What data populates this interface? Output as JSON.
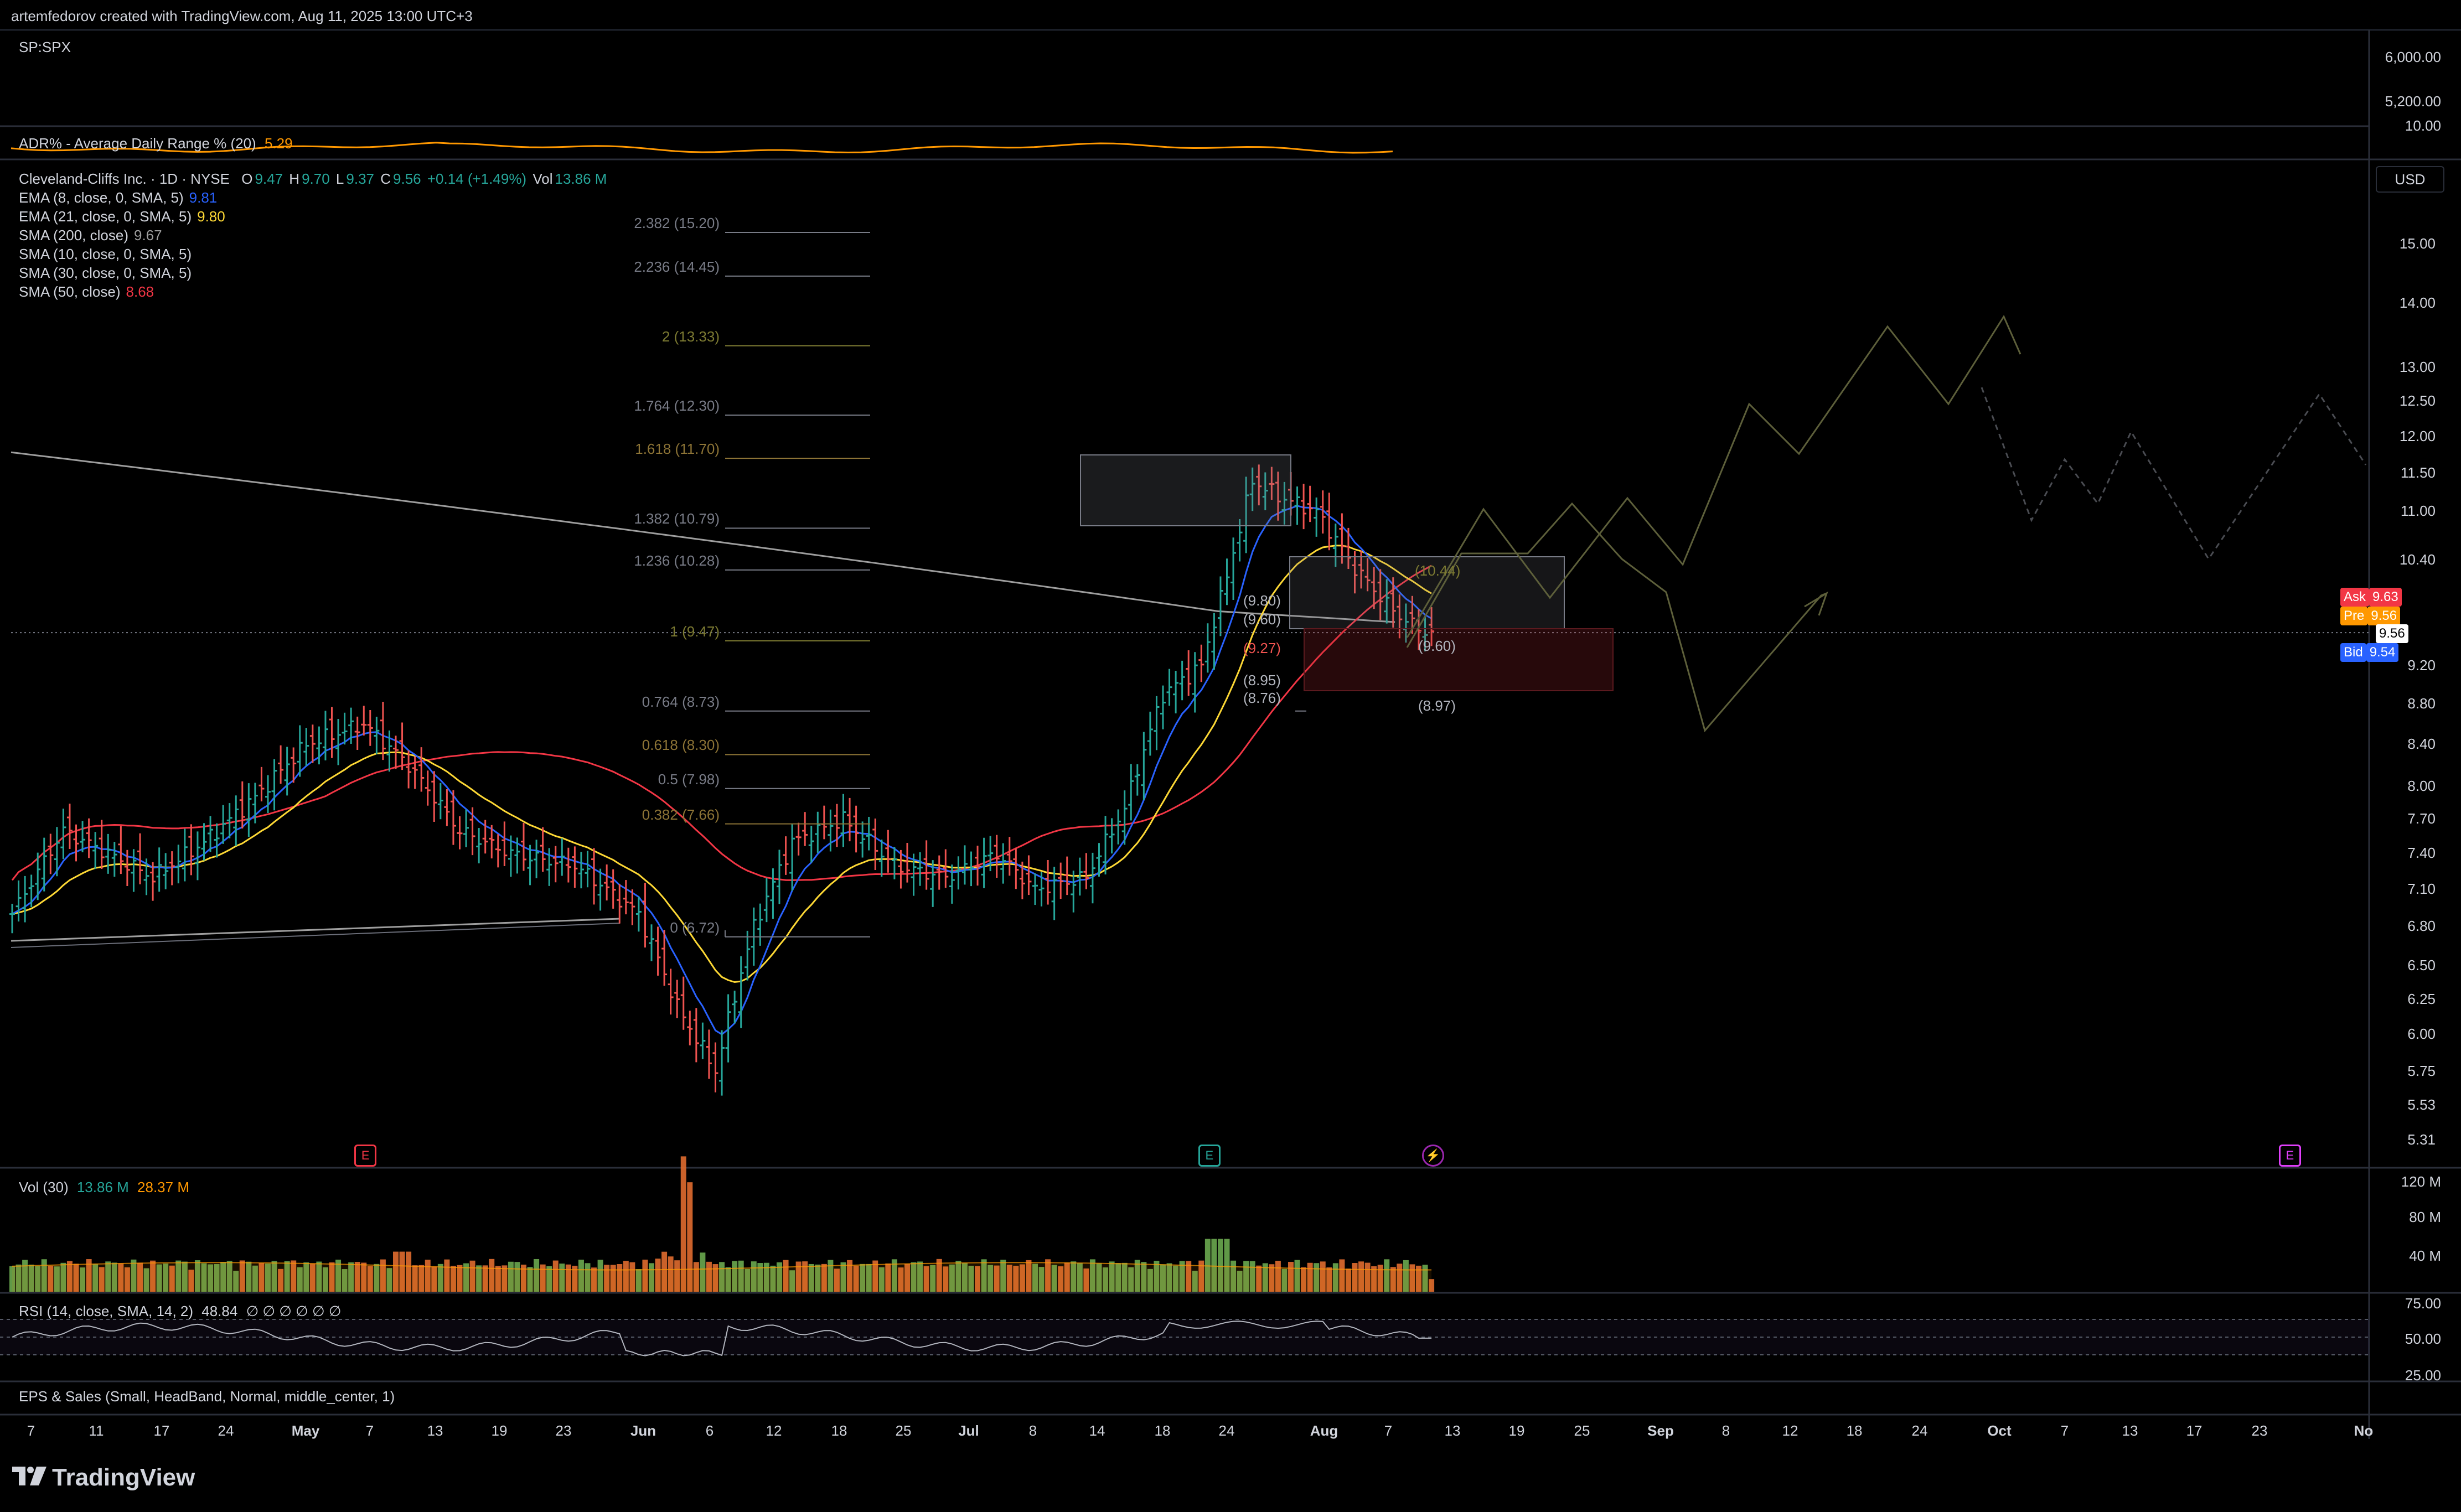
{
  "header": {
    "created_by": "artemfedorov created with TradingView.com, Aug 11, 2025 13:00 UTC+3"
  },
  "top_pane": {
    "symbol": "SP:SPX",
    "price_ticks": [
      "6,000.00",
      "5,200.00",
      "10.00"
    ]
  },
  "adr_indicator": {
    "label": "ADR% - Average Daily Range % (20)",
    "value": "5.29"
  },
  "main_legend": {
    "title": "Cleveland-Cliffs Inc. · 1D · NYSE",
    "open_label": "O",
    "open": "9.47",
    "high_label": "H",
    "high": "9.70",
    "low_label": "L",
    "low": "9.37",
    "close_label": "C",
    "close": "9.56",
    "change": "+0.14 (+1.49%)",
    "vol_label": "Vol",
    "vol": "13.86 M",
    "indicators": [
      {
        "label": "EMA (8, close, 0, SMA, 5)",
        "value": "9.81",
        "color": "#2962ff"
      },
      {
        "label": "EMA (21, close, 0, SMA, 5)",
        "value": "9.80",
        "color": "#fdd835"
      },
      {
        "label": "SMA (200, close)",
        "value": "9.67",
        "color": "#9e9e9e"
      },
      {
        "label": "SMA (10, close, 0, SMA, 5)",
        "value": "",
        "color": "#9e9e9e"
      },
      {
        "label": "SMA (30, close, 0, SMA, 5)",
        "value": "",
        "color": "#9e9e9e"
      },
      {
        "label": "SMA (50, close)",
        "value": "8.68",
        "color": "#f23645"
      }
    ]
  },
  "currency_button": "USD",
  "price_axis": [
    {
      "label": "15.00",
      "value": 15.0
    },
    {
      "label": "14.00",
      "value": 14.0
    },
    {
      "label": "13.00",
      "value": 13.0
    },
    {
      "label": "12.50",
      "value": 12.5
    },
    {
      "label": "12.00",
      "value": 12.0
    },
    {
      "label": "11.50",
      "value": 11.5
    },
    {
      "label": "11.00",
      "value": 11.0
    },
    {
      "label": "10.40",
      "value": 10.4
    },
    {
      "label": "9.20",
      "value": 9.2
    },
    {
      "label": "8.80",
      "value": 8.8
    },
    {
      "label": "8.40",
      "value": 8.4
    },
    {
      "label": "8.00",
      "value": 8.0
    },
    {
      "label": "7.70",
      "value": 7.7
    },
    {
      "label": "7.40",
      "value": 7.4
    },
    {
      "label": "7.10",
      "value": 7.1
    },
    {
      "label": "6.80",
      "value": 6.8
    },
    {
      "label": "6.50",
      "value": 6.5
    },
    {
      "label": "6.25",
      "value": 6.25
    },
    {
      "label": "6.00",
      "value": 6.0
    },
    {
      "label": "5.75",
      "value": 5.75
    },
    {
      "label": "5.53",
      "value": 5.53
    },
    {
      "label": "5.31",
      "value": 5.31
    }
  ],
  "price_tags": [
    {
      "label": "Ask",
      "value": "9.63",
      "color": "#f23645"
    },
    {
      "label": "Pre",
      "value": "9.56",
      "color": "#ff9800"
    },
    {
      "label": "",
      "value": "9.56",
      "color": "#ffffff"
    },
    {
      "label": "Bid",
      "value": "9.54",
      "color": "#2962ff"
    }
  ],
  "fibonacci": {
    "levels": [
      {
        "label": "2.382 (15.20)",
        "price": 15.2,
        "color": "#787b86"
      },
      {
        "label": "2.236 (14.45)",
        "price": 14.45,
        "color": "#787b86"
      },
      {
        "label": "2 (13.33)",
        "price": 13.33,
        "color": "#7c7a32"
      },
      {
        "label": "1.764 (12.30)",
        "price": 12.3,
        "color": "#787b86"
      },
      {
        "label": "1.618 (11.70)",
        "price": 11.7,
        "color": "#8d7436"
      },
      {
        "label": "1.382 (10.79)",
        "price": 10.79,
        "color": "#787b86"
      },
      {
        "label": "1.236 (10.28)",
        "price": 10.28,
        "color": "#787b86"
      },
      {
        "label": "1 (9.47)",
        "price": 9.47,
        "color": "#7c7a32"
      },
      {
        "label": "0.764 (8.73)",
        "price": 8.73,
        "color": "#787b86"
      },
      {
        "label": "0.618 (8.30)",
        "price": 8.3,
        "color": "#8d7436"
      },
      {
        "label": "0.5 (7.98)",
        "price": 7.98,
        "color": "#787b86"
      },
      {
        "label": "0.382 (7.66)",
        "price": 7.66,
        "color": "#8d7436"
      },
      {
        "label": "0 (6.72)",
        "price": 6.72,
        "color": "#787b86"
      }
    ]
  },
  "annotations": {
    "box_upper": "(10.44)",
    "box_level_1": "(9.80)",
    "box_level_2": "(9.60)",
    "box_level_3": "(9.27)",
    "box_level_4": "(8.95)",
    "box_level_5": "(8.76)",
    "right_level_1": "(9.60)",
    "right_level_2": "(8.97)"
  },
  "event_markers": [
    {
      "glyph": "E",
      "color": "#f23645",
      "date_index": 55
    },
    {
      "glyph": "E",
      "color": "#26a69a",
      "date_index": 187
    },
    {
      "glyph": "⚡",
      "color": "#9c27b0",
      "date_index": 222
    },
    {
      "glyph": "E",
      "color": "#e040fb",
      "date_index": 356
    }
  ],
  "volume_pane": {
    "label": "Vol (30)",
    "value_1": "13.86 M",
    "value_2": "28.37 M",
    "axis": [
      "120 M",
      "80 M",
      "40 M"
    ]
  },
  "rsi_pane": {
    "label": "RSI (14, close, SMA, 14, 2)",
    "value": "48.84",
    "empty_values": "∅ ∅ ∅ ∅ ∅ ∅",
    "axis": [
      "75.00",
      "50.00",
      "25.00"
    ]
  },
  "eps_pane": {
    "label": "EPS & Sales (Small, HeadBand, Normal, middle_center, 1)"
  },
  "time_axis": [
    {
      "label": "7",
      "month": false
    },
    {
      "label": "11",
      "month": false
    },
    {
      "label": "17",
      "month": false
    },
    {
      "label": "24",
      "month": false
    },
    {
      "label": "May",
      "month": true
    },
    {
      "label": "7",
      "month": false
    },
    {
      "label": "13",
      "month": false
    },
    {
      "label": "19",
      "month": false
    },
    {
      "label": "23",
      "month": false
    },
    {
      "label": "Jun",
      "month": true
    },
    {
      "label": "6",
      "month": false
    },
    {
      "label": "12",
      "month": false
    },
    {
      "label": "18",
      "month": false
    },
    {
      "label": "25",
      "month": false
    },
    {
      "label": "Jul",
      "month": true
    },
    {
      "label": "8",
      "month": false
    },
    {
      "label": "14",
      "month": false
    },
    {
      "label": "18",
      "month": false
    },
    {
      "label": "24",
      "month": false
    },
    {
      "label": "Aug",
      "month": true
    },
    {
      "label": "7",
      "month": false
    },
    {
      "label": "13",
      "month": false
    },
    {
      "label": "19",
      "month": false
    },
    {
      "label": "25",
      "month": false
    },
    {
      "label": "Sep",
      "month": true
    },
    {
      "label": "8",
      "month": false
    },
    {
      "label": "12",
      "month": false
    },
    {
      "label": "18",
      "month": false
    },
    {
      "label": "24",
      "month": false
    },
    {
      "label": "Oct",
      "month": true
    },
    {
      "label": "7",
      "month": false
    },
    {
      "label": "13",
      "month": false
    },
    {
      "label": "17",
      "month": false
    },
    {
      "label": "23",
      "month": false
    },
    {
      "label": "No",
      "month": true
    }
  ],
  "brand": "TradingView",
  "colors": {
    "up": "#26a69a",
    "down": "#ef5350",
    "ema8": "#2962ff",
    "ema21": "#fdd835",
    "sma50": "#f23645",
    "sma200": "#9e9e9e",
    "adr": "#ff9800",
    "projection": "#5d5f3a",
    "grid": "#1e222d"
  },
  "chart_data": {
    "type": "candlestick",
    "symbol": "Cleveland-Cliffs Inc. · 1D · NYSE",
    "series": [
      {
        "name": "EMA (8, close, 0, SMA, 5)",
        "last": 9.81
      },
      {
        "name": "EMA (21, close, 0, SMA, 5)",
        "last": 9.8
      },
      {
        "name": "SMA (200, close)",
        "last": 9.67
      },
      {
        "name": "SMA (50, close)",
        "last": 8.68
      }
    ],
    "last_bar": {
      "open": 9.47,
      "high": 9.7,
      "low": 9.37,
      "close": 9.56
    },
    "ylim": [
      5.31,
      15.2
    ],
    "y_scale": "log"
  }
}
